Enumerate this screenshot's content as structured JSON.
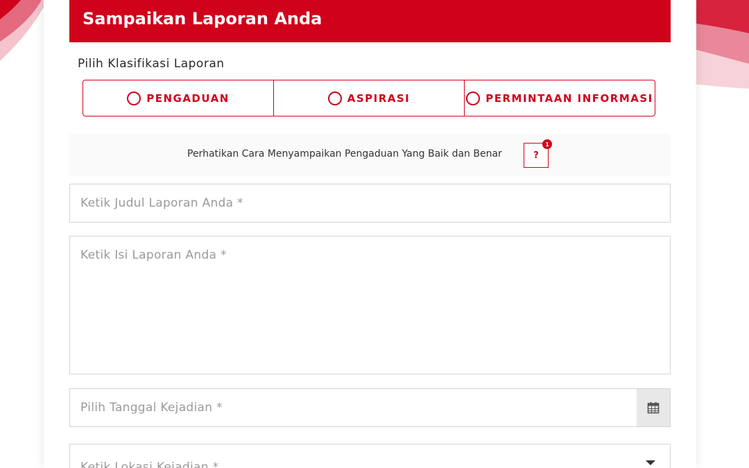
{
  "header": {
    "title": "Sampaikan Laporan Anda"
  },
  "classification": {
    "label": "Pilih Klasifikasi Laporan",
    "options": [
      "PENGADUAN",
      "ASPIRASI",
      "PERMINTAAN INFORMASI"
    ]
  },
  "notice": {
    "text": "Perhatikan Cara Menyampaikan Pengaduan Yang Baik dan Benar",
    "help_label": "?",
    "badge_count": "1"
  },
  "form": {
    "title_placeholder": "Ketik Judul Laporan Anda *",
    "body_placeholder": "Ketik Isi Laporan Anda *",
    "date_placeholder": "Pilih Tanggal Kejadian *",
    "location_placeholder": "Ketik Lokasi Kejadian *"
  },
  "icons": {
    "calendar": "calendar-icon",
    "dropdown": "chevron-down-icon",
    "help": "question-icon"
  },
  "colors": {
    "accent": "#d0021b",
    "placeholder": "#9a9a9a",
    "border": "#d4d4d4"
  }
}
